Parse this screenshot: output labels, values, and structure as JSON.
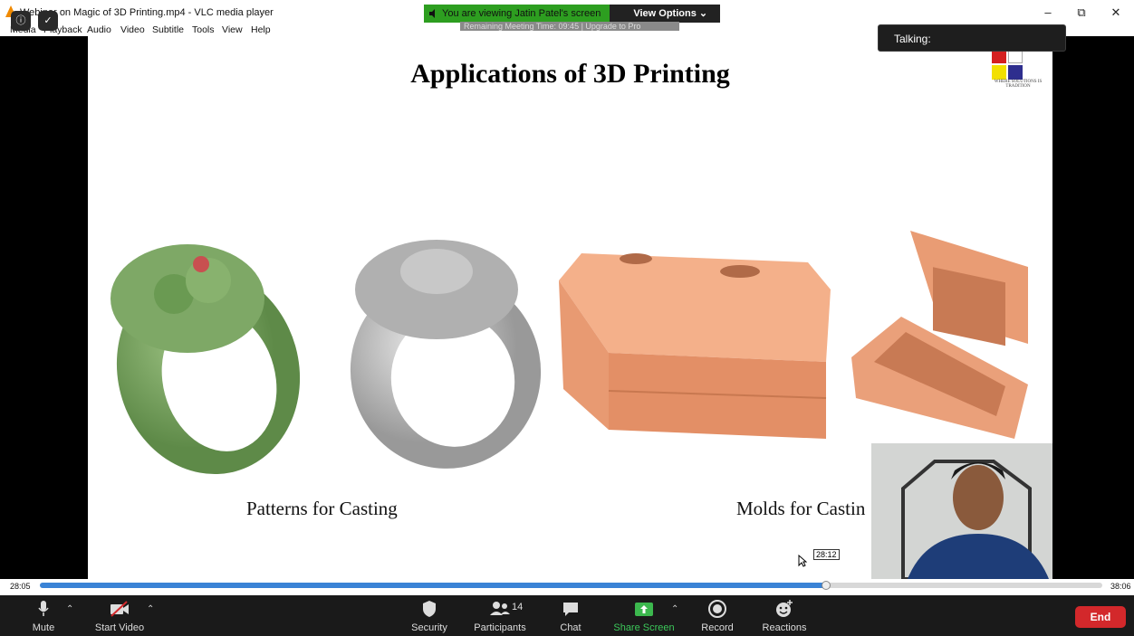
{
  "window": {
    "title": "Webinar on Magic of 3D Printing.mp4 - VLC media player",
    "minimize": "–",
    "restore": "⧉",
    "close": "✕"
  },
  "menu": [
    "Media",
    "Playback",
    "Audio",
    "Video",
    "Subtitle",
    "Tools",
    "View",
    "Help"
  ],
  "share": {
    "viewing_text": "You are viewing Jatin Patel's screen",
    "view_options": "View Options ⌄",
    "meeting_time": "Remaining Meeting Time: 09:45 | Upgrade to Pro"
  },
  "talking": "Talking:",
  "slide": {
    "title": "Applications of 3D Printing",
    "caption_left": "Patterns for Casting",
    "caption_right": "Molds for Castin",
    "logo_caption": "WHERE SOLUTIONS IS TRADITION",
    "logo_colors": [
      "#d42020",
      "#ffffff",
      "#f2e000",
      "#2e2e8e"
    ]
  },
  "player": {
    "elapsed": "28:05",
    "total": "38:06",
    "hover_time": "28:12",
    "progress": 0.74
  },
  "toolbar": {
    "mute": "Mute",
    "start_video": "Start Video",
    "security": "Security",
    "participants": "Participants",
    "participants_count": "14",
    "chat": "Chat",
    "share_screen": "Share Screen",
    "record": "Record",
    "reactions": "Reactions",
    "end": "End"
  },
  "colors": {
    "share_green": "#2d9e20",
    "end_red": "#d3282b",
    "progress_blue": "#3a83d6"
  }
}
